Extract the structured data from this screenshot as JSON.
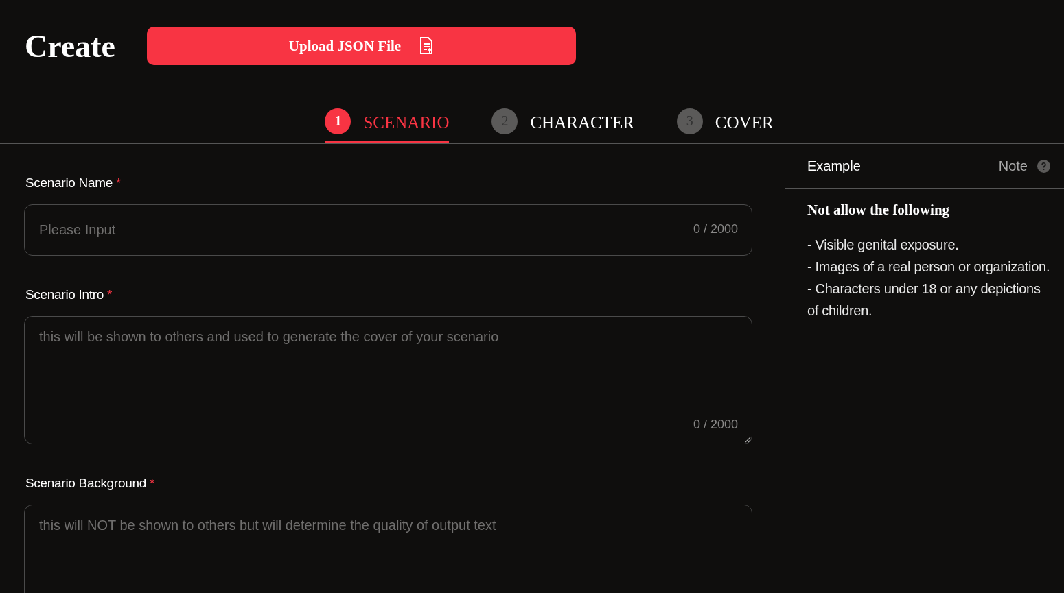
{
  "header": {
    "title": "Create",
    "upload_button": "Upload JSON File"
  },
  "steps": [
    {
      "number": "1",
      "label": "SCENARIO",
      "selected": true
    },
    {
      "number": "2",
      "label": "CHARACTER",
      "selected": false
    },
    {
      "number": "3",
      "label": "COVER",
      "selected": false
    }
  ],
  "fields": [
    {
      "kind": "input",
      "label": "Scenario Name",
      "required_mark": "*",
      "placeholder": "Please Input",
      "counter": "0 / 2000"
    },
    {
      "kind": "textarea",
      "label": "Scenario Intro",
      "required_mark": "*",
      "placeholder": "this will be shown to others and used to generate the cover of your scenario",
      "counter": "0 / 2000"
    },
    {
      "kind": "textarea",
      "label": "Scenario Background",
      "required_mark": "*",
      "placeholder": "this will NOT be shown to others but will determine the quality of output text"
    }
  ],
  "side_panel": {
    "title": "Example",
    "note": "Note",
    "heading": "Not allow the following",
    "rules": [
      "- Visible genital exposure.",
      "- Images of a real person or organization.",
      "- Characters under 18 or any depictions of children."
    ]
  }
}
